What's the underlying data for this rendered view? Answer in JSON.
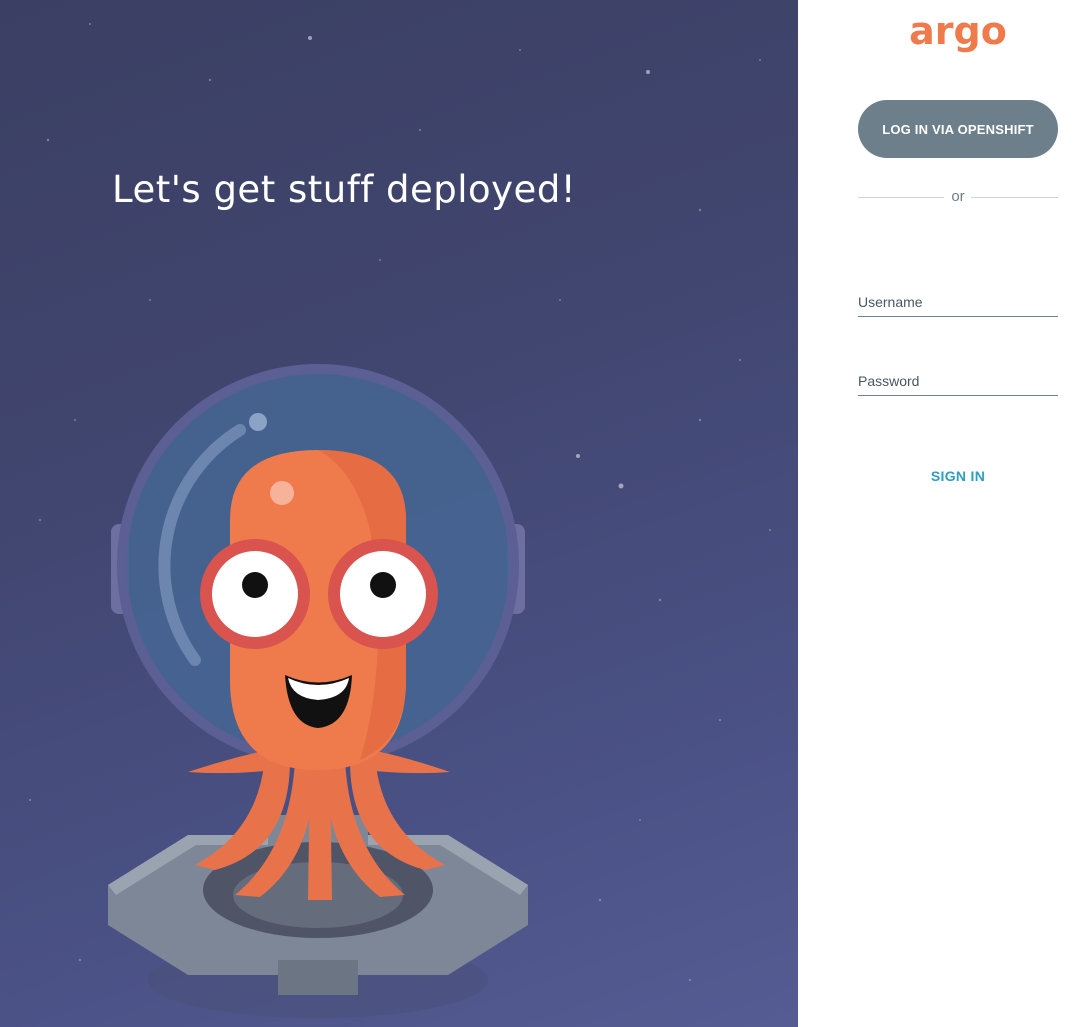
{
  "hero": {
    "tagline": "Let's get stuff deployed!"
  },
  "sidebar": {
    "logo_text": "argo",
    "sso_button_label": "LOG IN VIA OPENSHIFT",
    "divider_text": "or",
    "username_placeholder": "Username",
    "password_placeholder": "Password",
    "sign_in_label": "SIGN IN"
  },
  "colors": {
    "brand_orange": "#ef7b4d",
    "hero_background": "#434873",
    "sso_button": "#6d7f8b",
    "sign_in_link": "#2d9fc4"
  },
  "icons": [
    "argo-logo",
    "octopus-astronaut-mascot"
  ]
}
